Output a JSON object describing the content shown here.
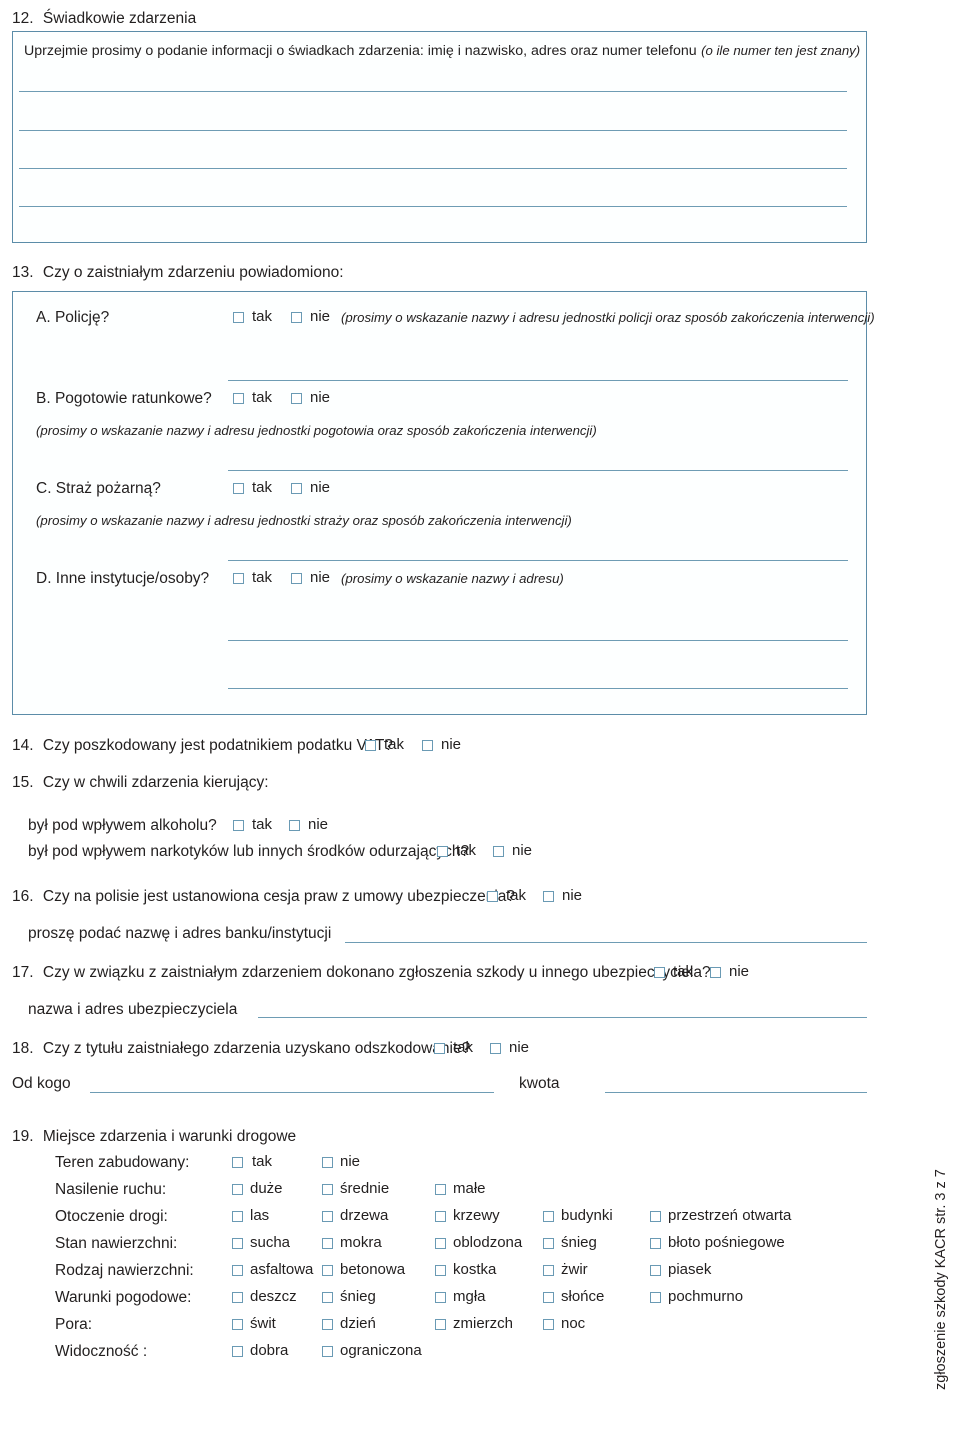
{
  "document": {
    "side_note": "zgłoszenie szkody KACR  str. 3 z 7",
    "accent_color": "#5b8ca8",
    "rule_color": "#6e9cb4",
    "text_color": "#231f20"
  },
  "q12": {
    "number": "12.",
    "title": "Świadkowie zdarzenia",
    "instruction": "Uprzejmie prosimy o podanie informacji o świadkach zdarzenia: imię i nazwisko, adres oraz numer telefonu",
    "instruction_italic": "(o ile numer ten jest znany)",
    "blank_lines": 4
  },
  "q13": {
    "number": "13.",
    "title": "Czy o zaistniałym zdarzeniu powiadomiono:",
    "yes_label": "tak",
    "no_label": "nie",
    "items": [
      {
        "letter": "A.",
        "label": "A. Policję?",
        "note": "(prosimy o wskazanie nazwy i adresu jednostki policji oraz sposób zakończenia interwencji)",
        "note_position": "inline"
      },
      {
        "letter": "B.",
        "label": "B. Pogotowie ratunkowe?",
        "note": "(prosimy o wskazanie nazwy i adresu jednostki pogotowia oraz sposób zakończenia interwencji)",
        "note_position": "below"
      },
      {
        "letter": "C.",
        "label": "C. Straż pożarną?",
        "note": "(prosimy o wskazanie nazwy i adresu jednostki straży oraz sposób zakończenia interwencji)",
        "note_position": "below"
      },
      {
        "letter": "D.",
        "label": "D. Inne instytucje/osoby?",
        "note": "(prosimy o wskazanie nazwy i adresu)",
        "note_position": "inline"
      }
    ]
  },
  "q14": {
    "number": "14.",
    "text": "Czy poszkodowany jest podatnikiem podatku VAT?",
    "yes_label": "tak",
    "no_label": "nie"
  },
  "q15": {
    "number": "15.",
    "text": "Czy w chwili zdarzenia kierujący:",
    "sub": [
      {
        "text": "był pod wpływem alkoholu?",
        "yes_label": "tak",
        "no_label": "nie"
      },
      {
        "text": "był pod wpływem narkotyków lub innych środków odurzających?",
        "yes_label": "tak",
        "no_label": "nie"
      }
    ]
  },
  "q16": {
    "number": "16.",
    "text": "Czy na polisie jest ustanowiona cesja praw z umowy ubezpieczenia?",
    "yes_label": "tak",
    "no_label": "nie",
    "sub_label": "proszę podać nazwę i adres banku/instytucji"
  },
  "q17": {
    "number": "17.",
    "text": "Czy w związku z zaistniałym zdarzeniem dokonano zgłoszenia szkody u innego ubezpieczyciela?",
    "yes_label": "tak",
    "no_label": "nie",
    "sub_label": "nazwa i adres ubezpieczyciela"
  },
  "q18": {
    "number": "18.",
    "text": "Czy z tytułu zaistniałego zdarzenia uzyskano odszkodowanie?",
    "yes_label": "tak",
    "no_label": "nie",
    "from_label": "Od kogo",
    "amount_label": "kwota"
  },
  "q19": {
    "number": "19.",
    "title": "Miejsce zdarzenia i warunki drogowe",
    "rows": [
      {
        "label": "Teren zabudowany:",
        "options": [
          "tak",
          "nie"
        ]
      },
      {
        "label": "Nasilenie ruchu:",
        "options": [
          "duże",
          "średnie",
          "małe"
        ]
      },
      {
        "label": "Otoczenie drogi:",
        "options": [
          "las",
          "drzewa",
          "krzewy",
          "budynki",
          "przestrzeń otwarta"
        ]
      },
      {
        "label": "Stan nawierzchni:",
        "options": [
          "sucha",
          "mokra",
          "oblodzona",
          "śnieg",
          "błoto pośniegowe"
        ]
      },
      {
        "label": "Rodzaj nawierzchni:",
        "options": [
          "asfaltowa",
          "betonowa",
          "kostka",
          "żwir",
          "piasek"
        ]
      },
      {
        "label": "Warunki pogodowe:",
        "options": [
          "deszcz",
          "śnieg",
          "mgła",
          "słońce",
          "pochmurno"
        ]
      },
      {
        "label": "Pora:",
        "options": [
          "świt",
          "dzień",
          "zmierzch",
          "noc"
        ]
      },
      {
        "label": "Widoczność :",
        "options": [
          "dobra",
          "ograniczona"
        ]
      }
    ]
  }
}
